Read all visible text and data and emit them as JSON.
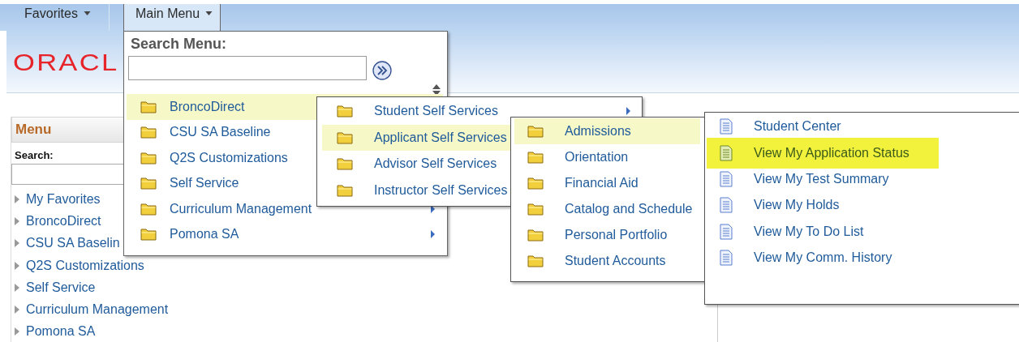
{
  "nav_tabs": [
    {
      "label": "Favorites",
      "selected": false
    },
    {
      "label": "Main Menu",
      "selected": true
    }
  ],
  "logo": {
    "text": "ORACL"
  },
  "sidebar": {
    "title": "Menu",
    "search_label": "Search:",
    "items": [
      {
        "label": "My Favorites"
      },
      {
        "label": "BroncoDirect"
      },
      {
        "label": "CSU SA Baselin"
      },
      {
        "label": "Q2S Customizations"
      },
      {
        "label": "Self Service"
      },
      {
        "label": "Curriculum Management"
      },
      {
        "label": "Pomona SA"
      }
    ]
  },
  "main_menu": {
    "search_label": "Search Menu:",
    "menus": [
      {
        "items": [
          {
            "kind": "folder",
            "label": "BroncoDirect",
            "selected": true,
            "arrow": false
          },
          {
            "kind": "folder",
            "label": "CSU SA Baseline",
            "selected": false,
            "arrow": false
          },
          {
            "kind": "folder",
            "label": "Q2S Customizations",
            "selected": false,
            "arrow": false
          },
          {
            "kind": "folder",
            "label": "Self Service",
            "selected": false,
            "arrow": false
          },
          {
            "kind": "folder",
            "label": "Curriculum Management",
            "selected": false,
            "arrow": true
          },
          {
            "kind": "folder",
            "label": "Pomona SA",
            "selected": false,
            "arrow": true
          }
        ]
      },
      {
        "items": [
          {
            "kind": "folder",
            "label": "Student Self Services",
            "selected": false,
            "arrow": true
          },
          {
            "kind": "folder",
            "label": "Applicant Self Services",
            "selected": true,
            "arrow": false
          },
          {
            "kind": "folder",
            "label": "Advisor Self Services",
            "selected": false,
            "arrow": false
          },
          {
            "kind": "folder",
            "label": "Instructor Self Services",
            "selected": false,
            "arrow": false
          }
        ]
      },
      {
        "items": [
          {
            "kind": "folder",
            "label": "Admissions",
            "selected": true,
            "arrow": false
          },
          {
            "kind": "folder",
            "label": "Orientation",
            "selected": false,
            "arrow": false
          },
          {
            "kind": "folder",
            "label": "Financial Aid",
            "selected": false,
            "arrow": false
          },
          {
            "kind": "folder",
            "label": "Catalog and Schedule",
            "selected": false,
            "arrow": false
          },
          {
            "kind": "folder",
            "label": "Personal Portfolio",
            "selected": false,
            "arrow": false
          },
          {
            "kind": "folder",
            "label": "Student Accounts",
            "selected": false,
            "arrow": false
          }
        ]
      },
      {
        "items": [
          {
            "kind": "page",
            "label": "Student Center",
            "selected": false,
            "arrow": false
          },
          {
            "kind": "page",
            "label": "View My Application Status",
            "selected": true,
            "arrow": false
          },
          {
            "kind": "page",
            "label": "View My Test Summary",
            "selected": false,
            "arrow": false
          },
          {
            "kind": "page",
            "label": "View My Holds",
            "selected": false,
            "arrow": false
          },
          {
            "kind": "page",
            "label": "View My To Do List",
            "selected": false,
            "arrow": false
          },
          {
            "kind": "page",
            "label": "View My Comm. History",
            "selected": false,
            "arrow": false
          }
        ]
      }
    ]
  }
}
